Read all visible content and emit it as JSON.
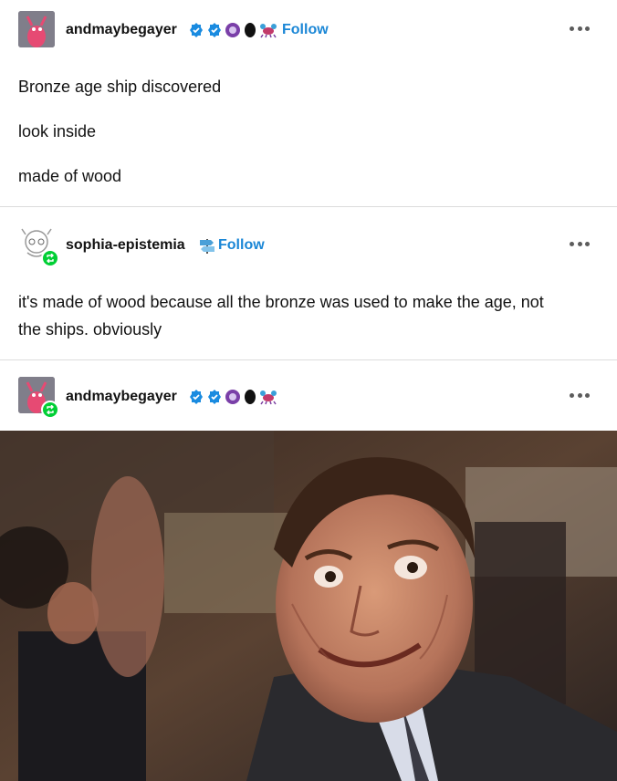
{
  "posts": [
    {
      "username": "andmaybegayer",
      "follow_label": "Follow",
      "paragraphs": [
        "Bronze age ship discovered",
        "look inside",
        "made of wood"
      ]
    },
    {
      "username": "sophia-epistemia",
      "follow_label": "Follow",
      "paragraphs": [
        "it's made of wood because all the bronze was used to make the age, not the ships. obviously"
      ]
    },
    {
      "username": "andmaybegayer",
      "paragraphs": []
    }
  ],
  "colors": {
    "accent": "#1b87d6",
    "reblog_green": "#01cf35",
    "verified_blue": "#1a8be0",
    "text": "#121212"
  },
  "icons": [
    "verified-badge-icon",
    "purple-badge-icon",
    "black-badge-icon",
    "crab-badge-icon",
    "reblog-icon",
    "more-options-icon",
    "signpost-icon"
  ],
  "gif": {
    "description_icon": "gif-image"
  }
}
